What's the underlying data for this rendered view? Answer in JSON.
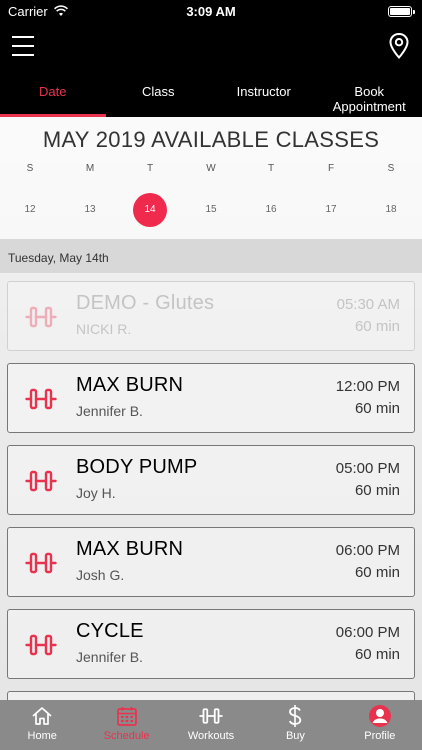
{
  "status_bar": {
    "carrier": "Carrier",
    "time": "3:09 AM"
  },
  "tabs": [
    {
      "label": "Date",
      "active": true
    },
    {
      "label": "Class",
      "active": false
    },
    {
      "label": "Instructor",
      "active": false
    },
    {
      "label": "Book Appointment",
      "active": false
    }
  ],
  "calendar": {
    "title": "MAY 2019 AVAILABLE CLASSES",
    "weekdays": [
      "S",
      "M",
      "T",
      "W",
      "T",
      "F",
      "S"
    ],
    "days": [
      "12",
      "13",
      "14",
      "15",
      "16",
      "17",
      "18"
    ],
    "selected_day": "14"
  },
  "date_header": "Tuesday, May 14th",
  "classes": [
    {
      "name": "DEMO - Glutes",
      "instructor": "NICKI R.",
      "time": "05:30 AM",
      "duration": "60 min",
      "past": true
    },
    {
      "name": "MAX BURN",
      "instructor": "Jennifer B.",
      "time": "12:00 PM",
      "duration": "60 min",
      "past": false
    },
    {
      "name": "BODY PUMP",
      "instructor": "Joy H.",
      "time": "05:00 PM",
      "duration": "60 min",
      "past": false
    },
    {
      "name": "MAX BURN",
      "instructor": "Josh G.",
      "time": "06:00 PM",
      "duration": "60 min",
      "past": false
    },
    {
      "name": "CYCLE",
      "instructor": "Jennifer B.",
      "time": "06:00 PM",
      "duration": "60 min",
      "past": false
    }
  ],
  "bottom_nav": [
    {
      "label": "Home",
      "icon": "home-icon",
      "active": false
    },
    {
      "label": "Schedule",
      "icon": "calendar-icon",
      "active": true
    },
    {
      "label": "Workouts",
      "icon": "dumbbell-icon",
      "active": false
    },
    {
      "label": "Buy",
      "icon": "dollar-icon",
      "active": false
    },
    {
      "label": "Profile",
      "icon": "profile-icon",
      "active": false
    }
  ],
  "colors": {
    "accent": "#e8334f",
    "bar_bg": "#000000",
    "bottom_bar_bg": "#8a8a8a"
  }
}
